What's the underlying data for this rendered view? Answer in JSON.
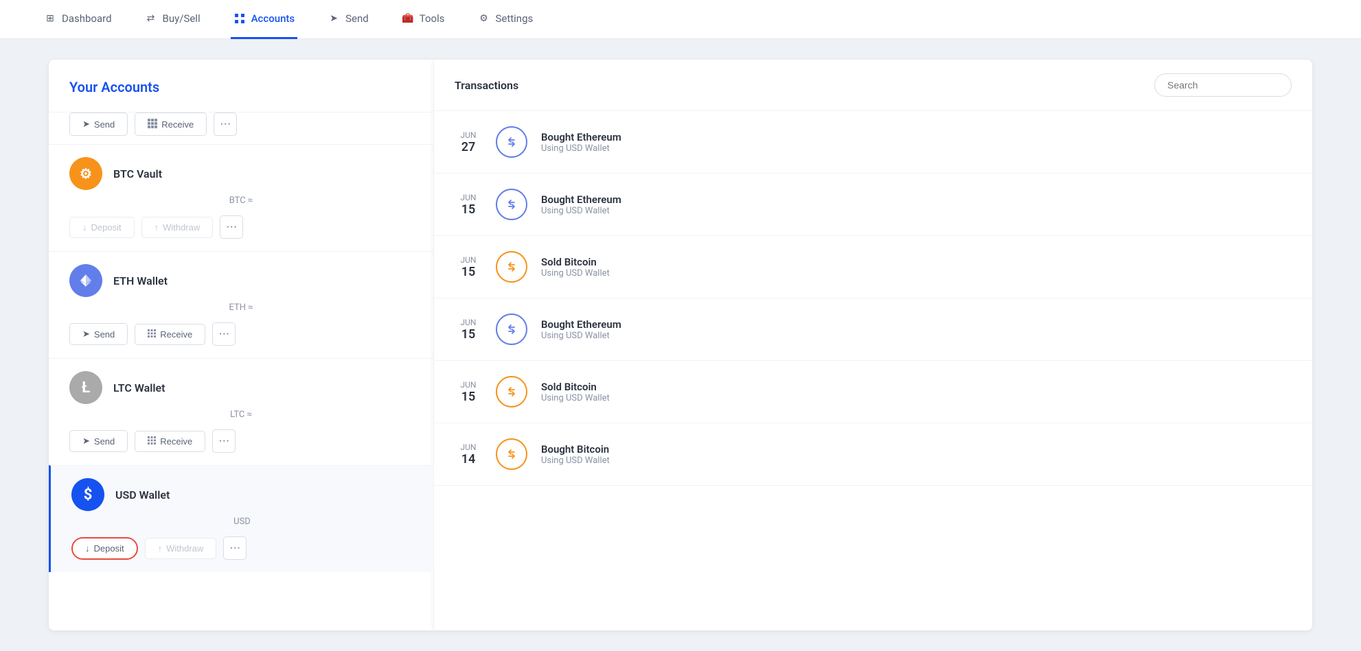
{
  "nav": {
    "items": [
      {
        "id": "dashboard",
        "label": "Dashboard",
        "icon": "⊞",
        "active": false
      },
      {
        "id": "buysell",
        "label": "Buy/Sell",
        "icon": "⇄",
        "active": false
      },
      {
        "id": "accounts",
        "label": "Accounts",
        "icon": "📋",
        "active": true
      },
      {
        "id": "send",
        "label": "Send",
        "icon": "➤",
        "active": false
      },
      {
        "id": "tools",
        "label": "Tools",
        "icon": "🧰",
        "active": false
      },
      {
        "id": "settings",
        "label": "Settings",
        "icon": "⚙",
        "active": false
      }
    ]
  },
  "sidebar": {
    "title": "Your Accounts",
    "accounts": [
      {
        "id": "btc-vault",
        "name": "BTC Vault",
        "balance_label": "BTC ≈",
        "balance_value": "",
        "type": "btc",
        "symbol": "⚙",
        "actions": [
          "Deposit",
          "Withdraw",
          "more"
        ],
        "active": false
      },
      {
        "id": "eth-wallet",
        "name": "ETH Wallet",
        "balance_label": "ETH ≈",
        "balance_value": "",
        "type": "eth",
        "symbol": "◈",
        "actions": [
          "Send",
          "Receive",
          "more"
        ],
        "active": false
      },
      {
        "id": "ltc-wallet",
        "name": "LTC Wallet",
        "balance_label": "LTC ≈",
        "balance_value": "",
        "type": "ltc",
        "symbol": "Ł",
        "actions": [
          "Send",
          "Receive",
          "more"
        ],
        "active": false
      },
      {
        "id": "usd-wallet",
        "name": "USD Wallet",
        "balance_label": "USD",
        "balance_value": "",
        "type": "usd",
        "symbol": "$",
        "actions": [
          "Deposit",
          "Withdraw",
          "more"
        ],
        "active": true
      }
    ]
  },
  "transactions": {
    "title": "Transactions",
    "search_placeholder": "Search",
    "items": [
      {
        "month": "JUN",
        "day": "27",
        "icon_type": "blue-swap",
        "name": "Bought Ethereum",
        "subtitle": "Using USD Wallet"
      },
      {
        "month": "JUN",
        "day": "15",
        "icon_type": "blue-swap",
        "name": "Bought Ethereum",
        "subtitle": "Using USD Wallet"
      },
      {
        "month": "JUN",
        "day": "15",
        "icon_type": "yellow-swap",
        "name": "Sold Bitcoin",
        "subtitle": "Using USD Wallet"
      },
      {
        "month": "JUN",
        "day": "15",
        "icon_type": "blue-swap",
        "name": "Bought Ethereum",
        "subtitle": "Using USD Wallet"
      },
      {
        "month": "JUN",
        "day": "15",
        "icon_type": "yellow-swap",
        "name": "Sold Bitcoin",
        "subtitle": "Using USD Wallet"
      },
      {
        "month": "JUN",
        "day": "14",
        "icon_type": "yellow-swap",
        "name": "Bought Bitcoin",
        "subtitle": "Using USD Wallet"
      }
    ]
  }
}
